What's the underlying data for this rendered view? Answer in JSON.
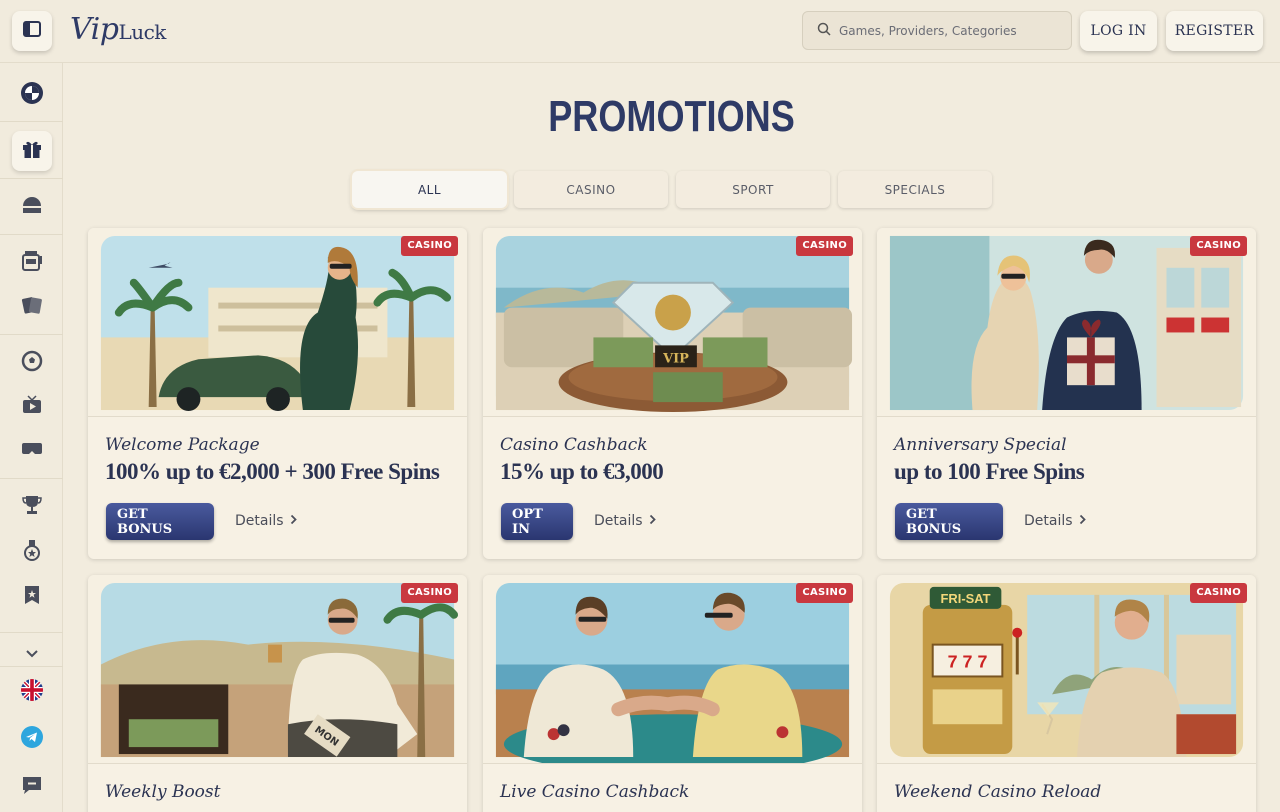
{
  "header": {
    "logo_vip": "Vip",
    "logo_luck": "Luck",
    "search_placeholder": "Games, Providers, Categories",
    "login_label": "LOG IN",
    "register_label": "REGISTER"
  },
  "sidebar": {
    "items": [
      {
        "icon": "bmw-icon"
      },
      {
        "icon": "gift-icon",
        "active": true
      },
      {
        "icon": "casino-building-icon"
      },
      {
        "icon": "slot-machine-icon"
      },
      {
        "icon": "cards-icon"
      },
      {
        "icon": "soccer-ball-icon"
      },
      {
        "icon": "tv-play-icon"
      },
      {
        "icon": "vr-headset-icon"
      },
      {
        "icon": "trophy-icon"
      },
      {
        "icon": "medal-icon"
      },
      {
        "icon": "bookmark-star-icon"
      },
      {
        "icon": "chevron-down-icon"
      },
      {
        "icon": "uk-flag-icon"
      },
      {
        "icon": "telegram-icon"
      },
      {
        "icon": "chat-icon"
      }
    ]
  },
  "page": {
    "title": "PROMOTIONS",
    "tabs": [
      {
        "label": "ALL",
        "active": true
      },
      {
        "label": "CASINO"
      },
      {
        "label": "SPORT"
      },
      {
        "label": "SPECIALS"
      }
    ]
  },
  "cards": [
    {
      "badge": "CASINO",
      "subtitle": "Welcome Package",
      "title": "100% up to €2,000 + 300 Free Spins",
      "cta": "GET BONUS",
      "details": "Details"
    },
    {
      "badge": "CASINO",
      "subtitle": "Casino Cashback",
      "title": "15% up to €3,000",
      "cta": "OPT IN",
      "details": "Details"
    },
    {
      "badge": "CASINO",
      "subtitle": "Anniversary Special",
      "title": "up to 100 Free Spins",
      "cta": "GET BONUS",
      "details": "Details"
    },
    {
      "badge": "CASINO",
      "subtitle": "Weekly Boost",
      "title": "",
      "cta": "",
      "details": ""
    },
    {
      "badge": "CASINO",
      "subtitle": "Live Casino Cashback",
      "title": "",
      "cta": "",
      "details": ""
    },
    {
      "badge": "CASINO",
      "subtitle": "Weekend Casino Reload",
      "title": "",
      "cta": "",
      "details": ""
    }
  ],
  "image_labels": {
    "vip_text": "VIP",
    "fri_sat": "FRI-SAT",
    "mon": "MON"
  },
  "colors": {
    "background": "#f2ecde",
    "accent_navy": "#2e3a66",
    "badge_red": "#c9383f",
    "button_blue": "#2a3670"
  }
}
